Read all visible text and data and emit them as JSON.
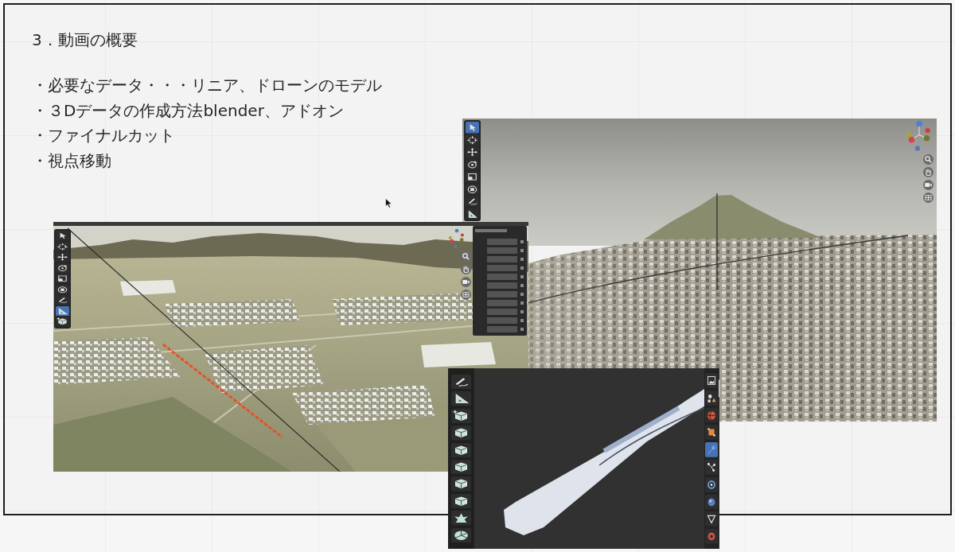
{
  "slide": {
    "title": "3．動画の概要",
    "bullets": [
      "・必要なデータ・・・リニア、ドローンのモデル",
      "・３Dデータの作成方法blender、アドオン",
      "・ファイナルカット",
      "・視点移動"
    ]
  },
  "screenshots": [
    {
      "kind": "city",
      "left_toolbar": [
        {
          "selected": true
        },
        {
          "selected": false
        },
        {
          "selected": false
        },
        {
          "selected": false
        },
        {
          "selected": false
        },
        {
          "selected": false
        },
        {
          "selected": false
        },
        {
          "selected": false
        }
      ]
    },
    {
      "kind": "terrain",
      "left_toolbar": [
        {
          "selected": false
        },
        {
          "selected": false
        },
        {
          "selected": false
        },
        {
          "selected": false
        },
        {
          "selected": false
        },
        {
          "selected": false
        },
        {
          "selected": false
        },
        {
          "selected": true
        },
        {
          "selected": false
        }
      ]
    },
    {
      "kind": "train",
      "left_toolbar": [
        {
          "selected": false
        },
        {
          "selected": false
        },
        {
          "selected": false
        },
        {
          "selected": false
        },
        {
          "selected": false
        },
        {
          "selected": false
        },
        {
          "selected": false
        },
        {
          "selected": false
        },
        {
          "selected": false
        },
        {
          "selected": false
        }
      ],
      "right_toolbar": [
        {
          "selected": false
        },
        {
          "selected": false
        },
        {
          "selected": false
        },
        {
          "selected": false
        },
        {
          "selected": true
        },
        {
          "selected": false
        },
        {
          "selected": false
        },
        {
          "selected": false
        },
        {
          "selected": false
        },
        {
          "selected": false
        }
      ]
    }
  ]
}
